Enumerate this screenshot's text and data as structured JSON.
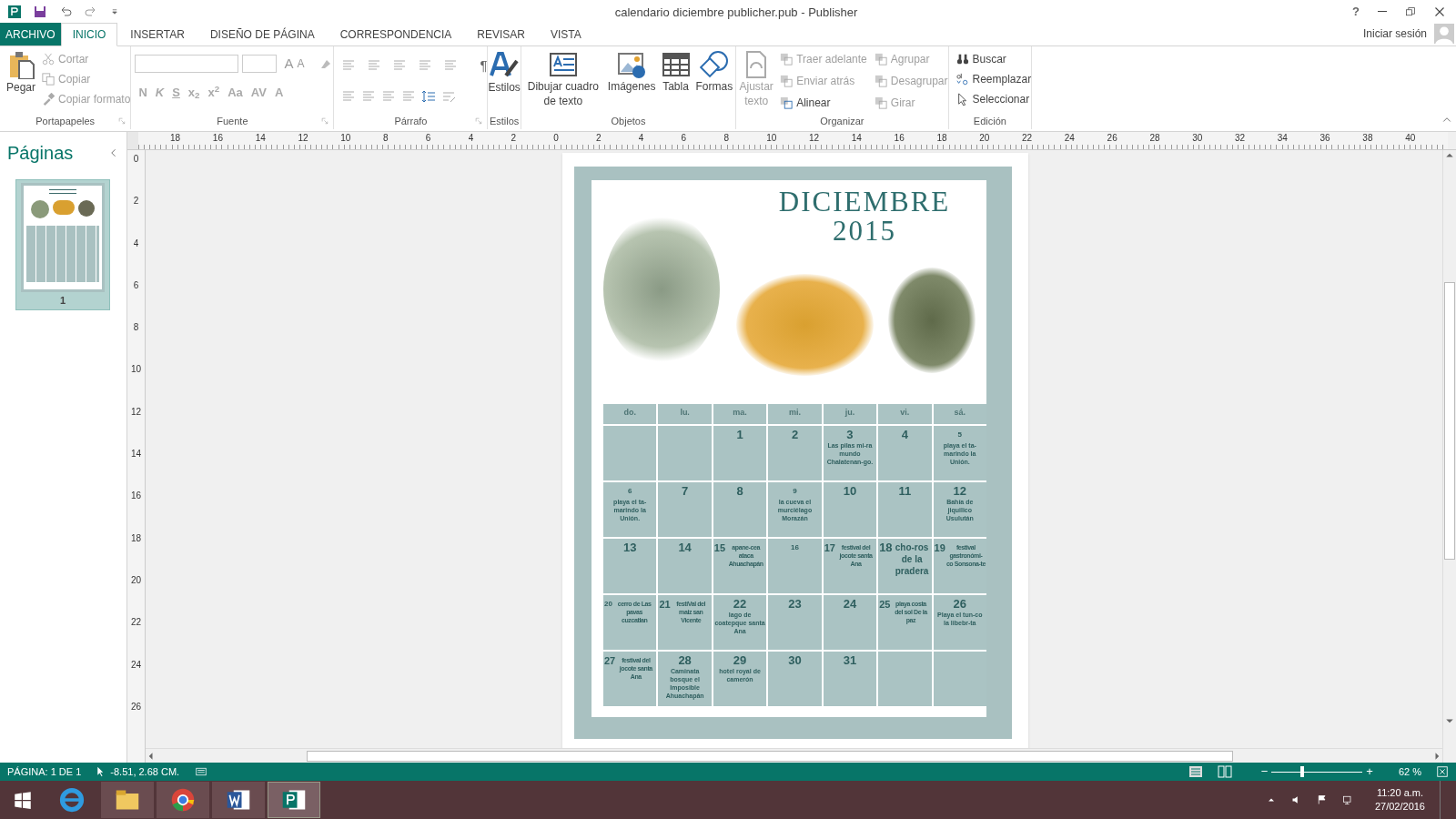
{
  "window": {
    "title": "calendario diciembre  publicher.pub - Publisher",
    "controls": [
      "?"
    ]
  },
  "menu_tabs": [
    {
      "label": "ARCHIVO",
      "kind": "file",
      "selected": false
    },
    {
      "label": "INICIO",
      "kind": "tab",
      "selected": true
    },
    {
      "label": "INSERTAR",
      "kind": "tab",
      "selected": false
    },
    {
      "label": "DISEÑO DE PÁGINA",
      "kind": "tab",
      "selected": false
    },
    {
      "label": "CORRESPONDENCIA",
      "kind": "tab",
      "selected": false
    },
    {
      "label": "REVISAR",
      "kind": "tab",
      "selected": false
    },
    {
      "label": "VISTA",
      "kind": "tab",
      "selected": false
    }
  ],
  "account": {
    "label": "Iniciar sesión"
  },
  "ribbon": {
    "clipboard": {
      "group": "Portapapeles",
      "paste": "Pegar",
      "items": [
        {
          "label": "Cortar",
          "disabled": true
        },
        {
          "label": "Copiar",
          "disabled": true
        },
        {
          "label": "Copiar formato",
          "disabled": true
        }
      ]
    },
    "font": {
      "group": "Fuente",
      "top_buttons": [
        "A",
        "A"
      ],
      "buttons": [
        "N",
        "K",
        "S",
        "x$_{2}$",
        "x$^{2}$",
        "Aa",
        "AV",
        "A"
      ]
    },
    "paragraph": {
      "group": "Párrafo",
      "pilcrow": "¶"
    },
    "styles": {
      "group": "Estilos",
      "label": "Estilos"
    },
    "objects": {
      "group": "Objetos",
      "items": [
        {
          "label": "Dibujar cuadro de texto"
        },
        {
          "label": "Imágenes"
        },
        {
          "label": "Tabla"
        },
        {
          "label": "Formas"
        }
      ]
    },
    "arrange": {
      "group": "Organizar",
      "wrap": {
        "label": "Ajustar texto",
        "disabled": true
      },
      "items": [
        {
          "label": "Traer adelante",
          "disabled": true
        },
        {
          "label": "Enviar atrás",
          "disabled": true
        },
        {
          "label": "Alinear",
          "disabled": false
        },
        {
          "label": "Agrupar",
          "disabled": true
        },
        {
          "label": "Desagrupar",
          "disabled": true
        },
        {
          "label": "Girar",
          "disabled": true
        }
      ]
    },
    "editing": {
      "group": "Edición",
      "items": [
        {
          "label": "Buscar"
        },
        {
          "label": "Reemplazar"
        },
        {
          "label": "Seleccionar"
        }
      ]
    }
  },
  "pages_pane": {
    "title": "Páginas",
    "pages": [
      {
        "label": "1",
        "selected": true
      }
    ]
  },
  "rulers": {
    "horizontal": [
      "18",
      "16",
      "14",
      "12",
      "10",
      "8",
      "6",
      "4",
      "2",
      "0",
      "2",
      "4",
      "6",
      "8",
      "10",
      "12",
      "14",
      "16",
      "18",
      "20",
      "22",
      "24",
      "26",
      "28",
      "30",
      "32",
      "34",
      "36",
      "38",
      "40"
    ],
    "vertical": [
      "0",
      "2",
      "4",
      "6",
      "8",
      "10",
      "12",
      "14",
      "16",
      "18",
      "20",
      "22",
      "24",
      "26"
    ]
  },
  "publication": {
    "title": "DICIEMBRE",
    "year": "2015",
    "calendar": {
      "headers": [
        "do.",
        "lu.",
        "ma.",
        "mi.",
        "ju.",
        "vi.",
        "sá."
      ],
      "rows": [
        [
          {},
          {},
          {
            "day": "1",
            "kind": "large"
          },
          {
            "day": "2",
            "kind": "large"
          },
          {
            "day": "3",
            "kind": "large",
            "inline": false,
            "note": "Las pilas mi-ra mundo Chalatenan-go."
          },
          {
            "day": "4",
            "kind": "large"
          },
          {
            "day": "5",
            "kind": "small",
            "inline": false,
            "note": "playa el ta-marindo la Unión."
          }
        ],
        [
          {
            "day": "6",
            "kind": "small",
            "inline": false,
            "note": "playa el ta-marindo la Unión."
          },
          {
            "day": "7",
            "kind": "large"
          },
          {
            "day": "8",
            "kind": "large"
          },
          {
            "day": "9",
            "kind": "small",
            "inline": false,
            "note": "la cueva el murciélago Morazán"
          },
          {
            "day": "10",
            "kind": "large"
          },
          {
            "day": "11",
            "kind": "large"
          },
          {
            "day": "12",
            "kind": "large",
            "inline": false,
            "note": "Bahía de jiquilico Usulután"
          }
        ],
        [
          {
            "day": "13",
            "kind": "large"
          },
          {
            "day": "14",
            "kind": "large"
          },
          {
            "day": "15",
            "kind": "large",
            "inline": true,
            "note": "apane-cea ataca Ahuachapán"
          },
          {
            "day": "16",
            "kind": "small"
          },
          {
            "day": "17",
            "kind": "large",
            "inline": true,
            "note": "festival del jocote santa Ana"
          },
          {
            "day": "18",
            "kind": "headline",
            "inline": true,
            "note": "cho-ros de la pradera"
          },
          {
            "day": "19",
            "kind": "large",
            "inline": true,
            "note": "festival gastronómi-co Sonsona-te"
          }
        ],
        [
          {
            "day": "20",
            "kind": "small",
            "inline": true,
            "note": "cerro de Las pavas cuzcatlan"
          },
          {
            "day": "21",
            "kind": "large",
            "inline": true,
            "note": "festiVal del maiz san Vicente"
          },
          {
            "day": "22",
            "kind": "large",
            "inline": false,
            "note": "lago de coatepque santa Ana"
          },
          {
            "day": "23",
            "kind": "large"
          },
          {
            "day": "24",
            "kind": "large"
          },
          {
            "day": "25",
            "kind": "large",
            "inline": true,
            "note": "playa costa del sol De la paz"
          },
          {
            "day": "26",
            "kind": "large",
            "inline": false,
            "note": "Playa el tun-co la libebr-ta"
          }
        ],
        [
          {
            "day": "27",
            "kind": "large",
            "inline": true,
            "note": "festival del jocote santa Ana"
          },
          {
            "day": "28",
            "kind": "large",
            "inline": false,
            "note": "Caminata bosque el Imposible Ahuachapán"
          },
          {
            "day": "29",
            "kind": "large",
            "inline": false,
            "note": "hotel royal de camerón"
          },
          {
            "day": "30",
            "kind": "large"
          },
          {
            "day": "31",
            "kind": "large"
          },
          {},
          {}
        ]
      ]
    }
  },
  "status_bar": {
    "page": "PÁGINA: 1 DE 1",
    "position": "-8.51, 2.68 CM.",
    "zoom": "62 %",
    "zoom_level": {
      "level": 0.32
    },
    "zoom_minus": "−",
    "zoom_plus": "+"
  },
  "taskbar": {
    "apps": [
      {
        "kind": "ie",
        "selected": false
      },
      {
        "kind": "explorer",
        "selected": false
      },
      {
        "kind": "chrome",
        "selected": false
      },
      {
        "kind": "word",
        "selected": false
      },
      {
        "kind": "publisher",
        "selected": true
      }
    ],
    "time": "11:20 a.m.",
    "date": "27/02/2016"
  }
}
